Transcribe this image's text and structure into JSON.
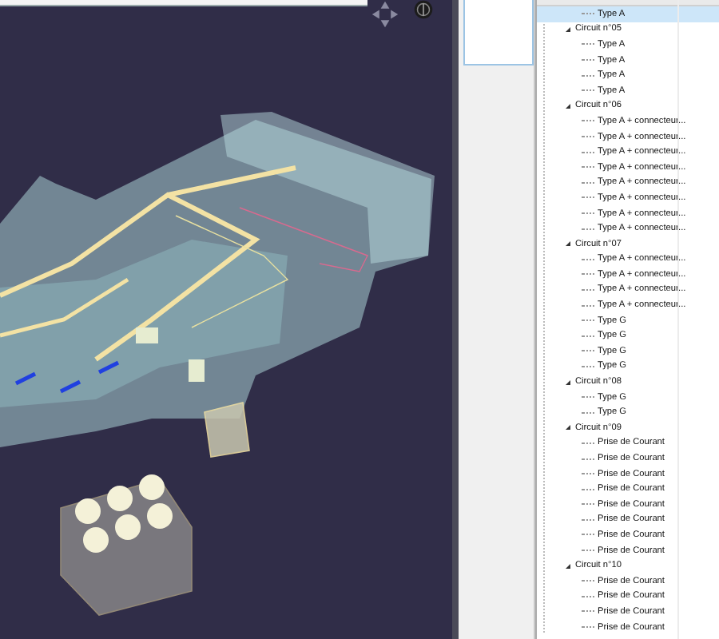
{
  "tree": {
    "continued_items": [
      {
        "label": "Type A",
        "selected": true
      }
    ],
    "circuits": [
      {
        "label": "Circuit n°05",
        "expanded": true,
        "selected": false,
        "children": [
          {
            "label": "Type A",
            "selected": false
          },
          {
            "label": "Type A",
            "selected": false
          },
          {
            "label": "Type A",
            "selected": false
          },
          {
            "label": "Type A",
            "selected": false
          }
        ]
      },
      {
        "label": "Circuit n°06",
        "expanded": true,
        "selected": false,
        "children": [
          {
            "label": "Type A + connecteur...",
            "selected": false
          },
          {
            "label": "Type A + connecteur...",
            "selected": false
          },
          {
            "label": "Type A + connecteur...",
            "selected": false
          },
          {
            "label": "Type A + connecteur...",
            "selected": false
          },
          {
            "label": "Type A + connecteur...",
            "selected": false
          },
          {
            "label": "Type A + connecteur...",
            "selected": false
          },
          {
            "label": "Type A + connecteur...",
            "selected": false
          },
          {
            "label": "Type A + connecteur...",
            "selected": false
          }
        ]
      },
      {
        "label": "Circuit n°07",
        "expanded": true,
        "selected": false,
        "children": [
          {
            "label": "Type A + connecteur...",
            "selected": false
          },
          {
            "label": "Type A + connecteur...",
            "selected": false
          },
          {
            "label": "Type A + connecteur...",
            "selected": false
          },
          {
            "label": "Type A + connecteur...",
            "selected": false
          },
          {
            "label": "Type G",
            "selected": false
          },
          {
            "label": "Type G",
            "selected": false
          },
          {
            "label": "Type G",
            "selected": false
          },
          {
            "label": "Type G",
            "selected": false
          }
        ]
      },
      {
        "label": "Circuit n°08",
        "expanded": true,
        "selected": false,
        "children": [
          {
            "label": "Type G",
            "selected": false
          },
          {
            "label": "Type G",
            "selected": false
          }
        ]
      },
      {
        "label": "Circuit n°09",
        "expanded": true,
        "selected": false,
        "children": [
          {
            "label": "Prise de Courant",
            "selected": false
          },
          {
            "label": "Prise de Courant",
            "selected": false
          },
          {
            "label": "Prise de Courant",
            "selected": false
          },
          {
            "label": "Prise de Courant",
            "selected": false
          },
          {
            "label": "Prise de Courant",
            "selected": false
          },
          {
            "label": "Prise de Courant",
            "selected": false
          },
          {
            "label": "Prise de Courant",
            "selected": false
          },
          {
            "label": "Prise de Courant",
            "selected": false
          }
        ]
      },
      {
        "label": "Circuit n°10",
        "expanded": true,
        "selected": false,
        "children": [
          {
            "label": "Prise de Courant",
            "selected": false
          },
          {
            "label": "Prise de Courant",
            "selected": false
          },
          {
            "label": "Prise de Courant",
            "selected": false
          },
          {
            "label": "Prise de Courant",
            "selected": false
          }
        ]
      }
    ]
  }
}
